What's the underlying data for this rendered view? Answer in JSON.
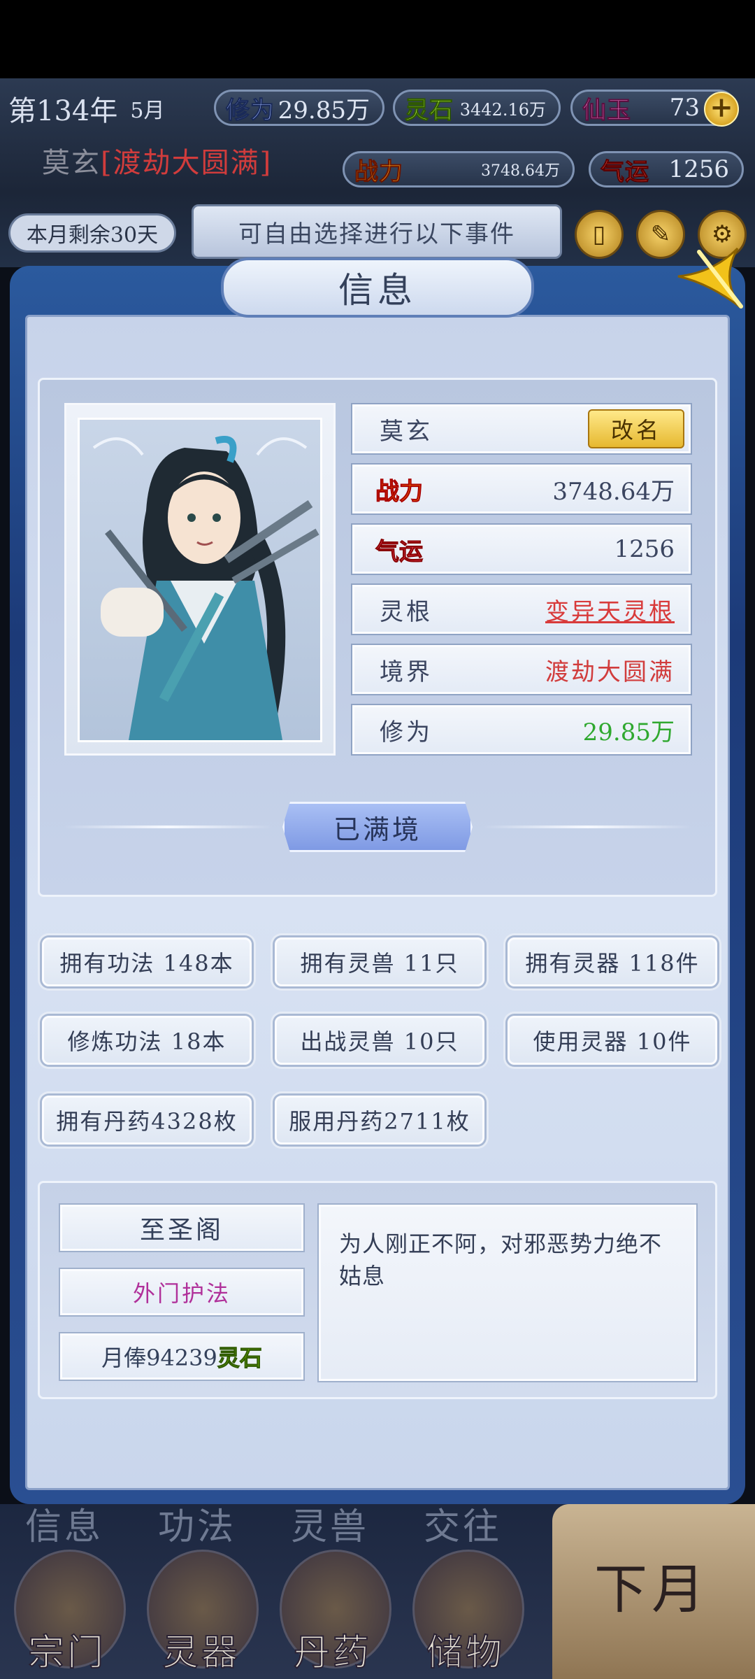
{
  "hud": {
    "year": "第134年",
    "month": "5月",
    "cultivation": {
      "label": "修为",
      "value": "29.85万"
    },
    "spirit_stone": {
      "label": "灵石",
      "value": "3442.16万"
    },
    "immortal_jade": {
      "label": "仙玉",
      "value": "73"
    },
    "char_name": "莫玄",
    "realm_bracketed": "[渡劫大圆满]",
    "power": {
      "label": "战力",
      "value": "3748.64万"
    },
    "luck": {
      "label": "气运",
      "value": "1256"
    },
    "days_remaining": "本月剩余30天",
    "event_prompt": "可自由选择进行以下事件"
  },
  "panel": {
    "title": "信息",
    "name": "莫玄",
    "rename_label": "改名",
    "power_label": "战力",
    "power_value": "3748.64万",
    "luck_label": "气运",
    "luck_value": "1256",
    "root_label": "灵根",
    "root_value": "变异天灵根",
    "realm_label": "境界",
    "realm_value": "渡劫大圆满",
    "cultivation_label": "修为",
    "cultivation_value": "29.85万",
    "full_button": "已满境",
    "stats": [
      "拥有功法 148本",
      "拥有灵兽  11只",
      "拥有灵器 118件",
      "修炼功法  18本",
      "出战灵兽  10只",
      "使用灵器  10件",
      "拥有丹药4328枚",
      "服用丹药2711枚"
    ],
    "sect_name": "至圣阁",
    "sect_role": "外门护法",
    "salary_prefix": "月俸94239",
    "salary_unit": "灵石",
    "description": "为人刚正不阿，对邪恶势力绝不姑息"
  },
  "nav": {
    "top_labels": [
      "信息",
      "功法",
      "灵兽",
      "交往"
    ],
    "buttons": [
      "宗门",
      "灵器",
      "丹药",
      "储物"
    ],
    "next_month": "下月"
  },
  "colors": {
    "realm_red": "#d13c3c",
    "cultivation_green": "#2fa82f",
    "sect_role_purple": "#b0309a",
    "root_red": "#d83a3a"
  }
}
